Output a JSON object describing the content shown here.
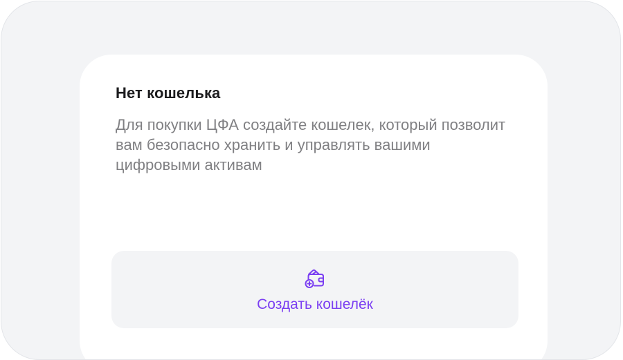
{
  "card": {
    "title": "Нет кошелька",
    "description": "Для покупки ЦФА создайте кошелек, который позволит вам безопасно хранить и управлять вашими цифровыми активам"
  },
  "action": {
    "label": "Создать кошелёк",
    "icon": "wallet-add-icon",
    "color": "#7b3ff2"
  },
  "colors": {
    "background": "#f3f4f6",
    "card": "#ffffff",
    "title": "#1c1c1e",
    "text": "#808083",
    "accent": "#7b3ff2"
  }
}
